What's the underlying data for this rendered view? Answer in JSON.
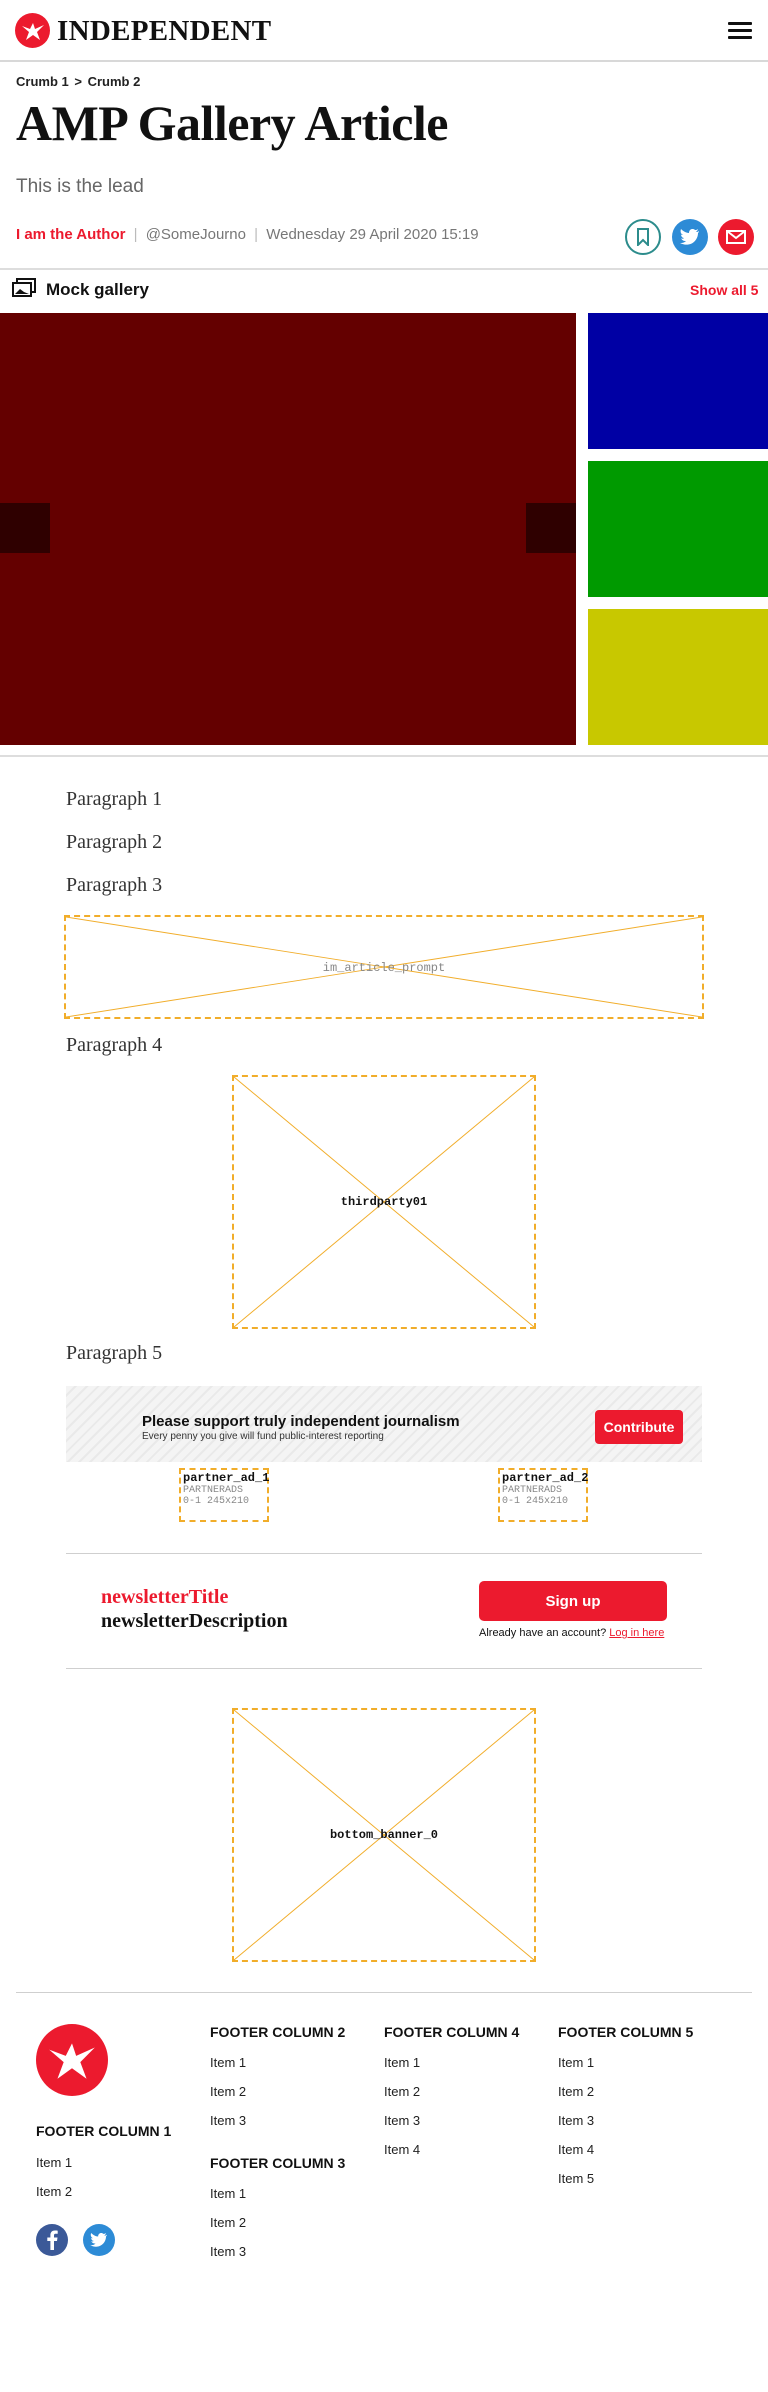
{
  "header": {
    "brand": "INDEPENDENT"
  },
  "breadcrumb": {
    "items": [
      "Crumb 1",
      "Crumb 2"
    ],
    "separator": ">"
  },
  "article": {
    "title": "AMP Gallery Article",
    "lead": "This is the lead",
    "author": "I am the Author",
    "handle": "@SomeJourno",
    "date": "Wednesday 29 April 2020 15:19",
    "paragraphs": [
      "Paragraph 1",
      "Paragraph 2",
      "Paragraph 3",
      "Paragraph 4",
      "Paragraph 5"
    ]
  },
  "gallery": {
    "title": "Mock gallery",
    "show_all": "Show all 5",
    "main_color": "#640000",
    "thumb_colors": [
      "#0000a4",
      "#009a00",
      "#c8c800"
    ]
  },
  "ads": {
    "in_article": "im_article_prompt",
    "thirdparty": "thirdparty01",
    "bottom": "bottom_banner_0",
    "partners": [
      {
        "name": "partner_ad_1",
        "type": "PARTNERADS",
        "size": "0-1 245x210"
      },
      {
        "name": "partner_ad_2",
        "type": "PARTNERADS",
        "size": "0-1 245x210"
      }
    ]
  },
  "support": {
    "title": "Please support truly independent journalism",
    "subtitle": "Every penny you give will fund public-interest reporting",
    "button": "Contribute"
  },
  "newsletter": {
    "title": "newsletterTitle",
    "description": "newsletterDescription",
    "button": "Sign up",
    "login_prefix": "Already have an account?",
    "login_link": "Log in here"
  },
  "footer": {
    "columns": [
      {
        "title": "FOOTER COLUMN 1",
        "items": [
          "Item 1",
          "Item 2"
        ]
      },
      {
        "title": "FOOTER COLUMN 2",
        "items": [
          "Item 1",
          "Item 2",
          "Item 3"
        ]
      },
      {
        "title": "FOOTER COLUMN 3",
        "items": [
          "Item 1",
          "Item 2",
          "Item 3"
        ]
      },
      {
        "title": "FOOTER COLUMN 4",
        "items": [
          "Item 1",
          "Item 2",
          "Item 3",
          "Item 4"
        ]
      },
      {
        "title": "FOOTER COLUMN 5",
        "items": [
          "Item 1",
          "Item 2",
          "Item 3",
          "Item 4",
          "Item 5"
        ]
      }
    ]
  },
  "colors": {
    "brand_red": "#ec1a2e",
    "placeholder_orange": "#f1ad2a"
  }
}
